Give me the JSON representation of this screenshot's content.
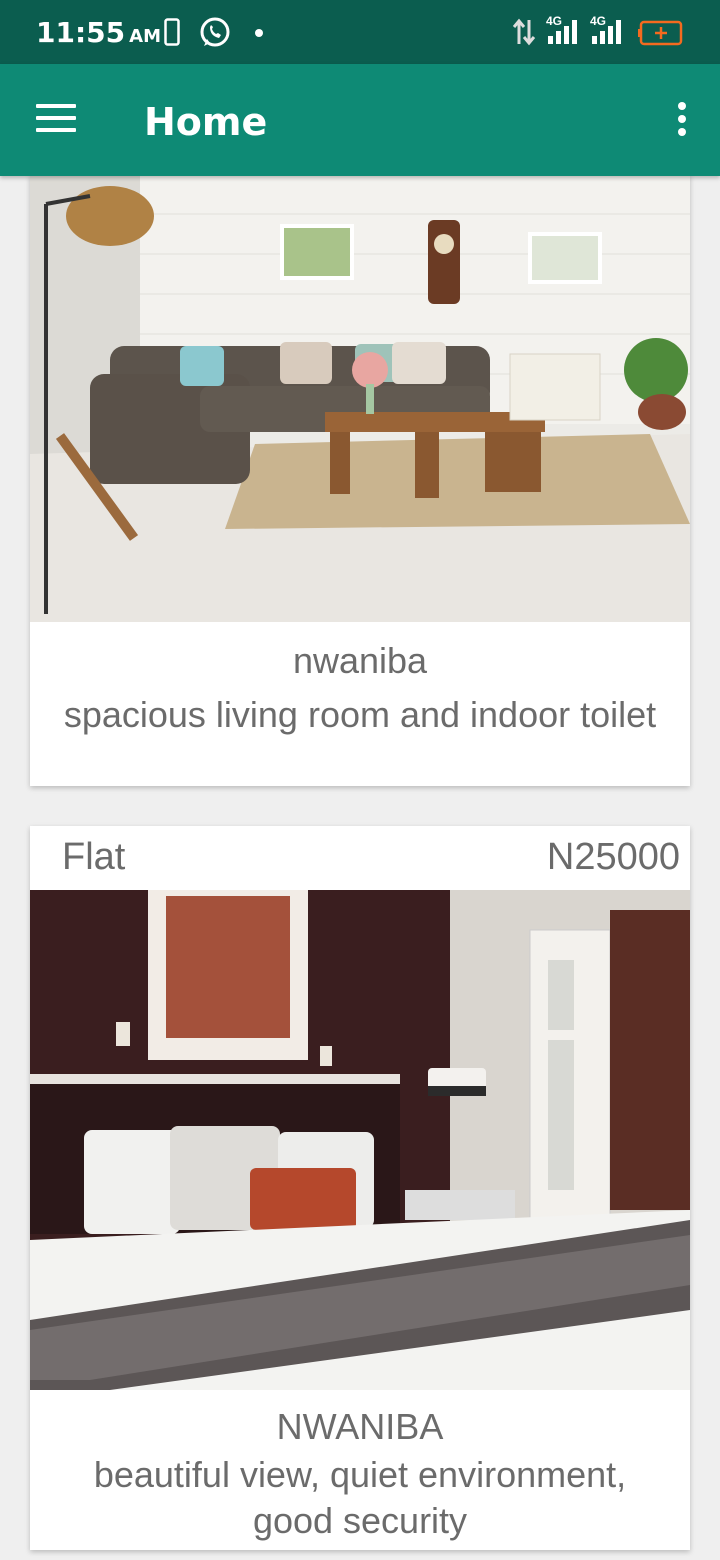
{
  "status_bar": {
    "time": "11:55",
    "ampm": "AM",
    "network_1": "4G",
    "network_2": "4G"
  },
  "app_bar": {
    "title": "Home",
    "menu_icon": "hamburger-menu-icon",
    "overflow_icon": "more-vert-icon"
  },
  "listings": [
    {
      "location": "nwaniba",
      "description": "spacious living room and indoor toilet",
      "image": "living-room-photo"
    },
    {
      "type": "Flat",
      "price": "N25000",
      "location": "NWANIBA",
      "description": "beautiful view, quiet environment, good security",
      "image": "bedroom-photo"
    }
  ],
  "colors": {
    "status_bar": "#0b5d4f",
    "app_bar": "#0e8a75",
    "background": "#efefef",
    "text": "#6b6b6b"
  }
}
